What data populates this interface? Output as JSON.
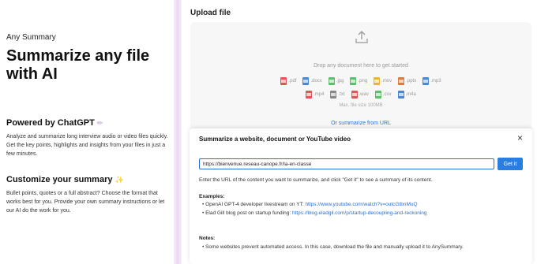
{
  "left": {
    "brand": "Any Summary",
    "headline": "Summarize any file with AI",
    "powered": {
      "title": "Powered by ChatGPT",
      "emoji": "✏",
      "body": "Analyze and summarize long interview audio or video files quickly. Get the key points, highlights and insights from your files in just a few minutes."
    },
    "customize": {
      "title": "Customize your summary",
      "emoji": "✨",
      "body": "Bullet points, quotes or a full abstract? Choose the format that works best for you. Provide your own summary instructions or let our AI do the work for you."
    }
  },
  "upload": {
    "title": "Upload file",
    "drop_text": "Drop any document here to get started",
    "types_row1": [
      {
        "label": ".pdf",
        "color": "#e05656"
      },
      {
        "label": ".docx",
        "color": "#4a86d8"
      },
      {
        "label": ".jpg",
        "color": "#5cbf6a"
      },
      {
        "label": ".png",
        "color": "#5cbf6a"
      },
      {
        "label": ".mov",
        "color": "#e9b23c"
      },
      {
        "label": ".pptx",
        "color": "#e07a3c"
      },
      {
        "label": ".mp3",
        "color": "#4a86d8"
      }
    ],
    "types_row2": [
      {
        "label": ".mp4",
        "color": "#e05656"
      },
      {
        "label": ".txt",
        "color": "#888888"
      },
      {
        "label": ".wav",
        "color": "#e05656"
      },
      {
        "label": ".csv",
        "color": "#5cbf6a"
      },
      {
        "label": ".m4a",
        "color": "#4a86d8"
      }
    ],
    "max_size": "Max. file size 100MB",
    "or_url": "Or summarize from URL"
  },
  "modal": {
    "title": "Summarize a website, document or YouTube video",
    "url_value": "https://bienvenue.reseau-canope.fr/la-en-classe",
    "get_it": "Get it",
    "instructions": "Enter the URL of the content you want to summarize, and click \"Get it\" to see a summary of its content.",
    "examples_label": "Examples:",
    "examples": [
      {
        "text": "OpenAI GPT-4 developer livestream on YT: ",
        "link": "https://www.youtube.com/watch?v=outcGtbnMuQ"
      },
      {
        "text": "Elad Gill blog post on startup funding: ",
        "link": "https://blog.eladgil.com/p/startup-decoupling-and-reckoning"
      }
    ],
    "notes_label": "Notes:",
    "notes": [
      "Some websites prevent automated access. In this case, download the file and manually upload it to AnySummary."
    ]
  },
  "colors": {
    "accent": "#2a7de1",
    "link": "#2a6fd6",
    "divider": "#ead9f2"
  }
}
